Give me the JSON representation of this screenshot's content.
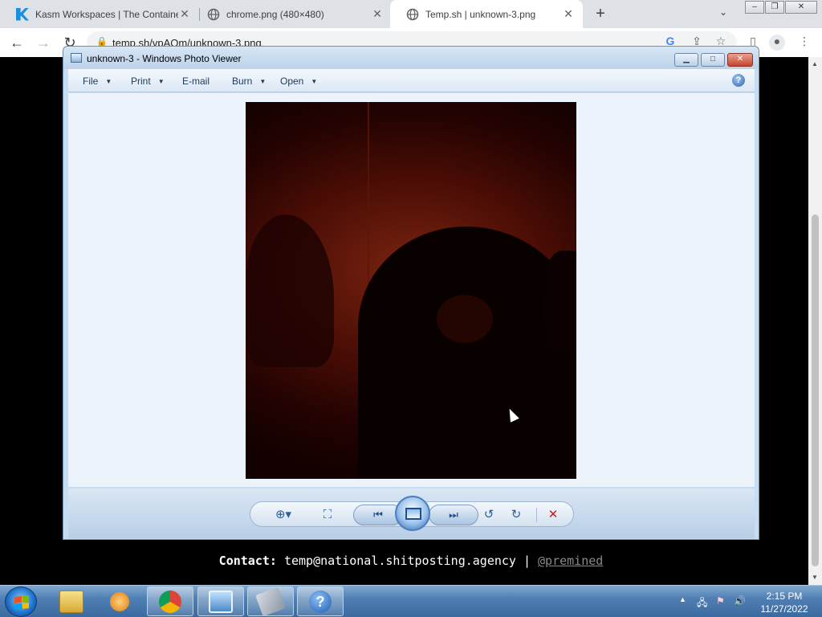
{
  "browser": {
    "tabs": [
      {
        "title": "Kasm Workspaces | The Containe",
        "active": false,
        "favicon": "kasm-icon"
      },
      {
        "title": "chrome.png (480×480)",
        "active": false,
        "favicon": "globe-icon"
      },
      {
        "title": "Temp.sh | unknown-3.png",
        "active": true,
        "favicon": "globe-icon"
      }
    ],
    "new_tab_label": "+",
    "address": "temp.sh/vpAQm/unknown-3.png"
  },
  "viewer": {
    "title": "unknown-3 - Windows Photo Viewer",
    "menu": [
      {
        "label": "File",
        "has_dropdown": true
      },
      {
        "label": "Print",
        "has_dropdown": true
      },
      {
        "label": "E-mail",
        "has_dropdown": false
      },
      {
        "label": "Burn",
        "has_dropdown": true
      },
      {
        "label": "Open",
        "has_dropdown": true
      }
    ],
    "help_label": "?"
  },
  "page": {
    "contact_label": "Contact:",
    "contact_email": "temp@national.shitposting.agency",
    "separator": "|",
    "handle": "@premined"
  },
  "taskbar": {
    "apps": [
      "file-explorer-icon",
      "media-player-icon",
      "chrome-icon",
      "photo-viewer-icon",
      "settings-tool-icon",
      "help-icon"
    ],
    "clock_time": "2:15 PM",
    "clock_date": "11/27/2022"
  },
  "colors": {
    "accent": "#4c7fc0",
    "taskbar": "#3b6aa0",
    "delete": "#c0201a"
  }
}
